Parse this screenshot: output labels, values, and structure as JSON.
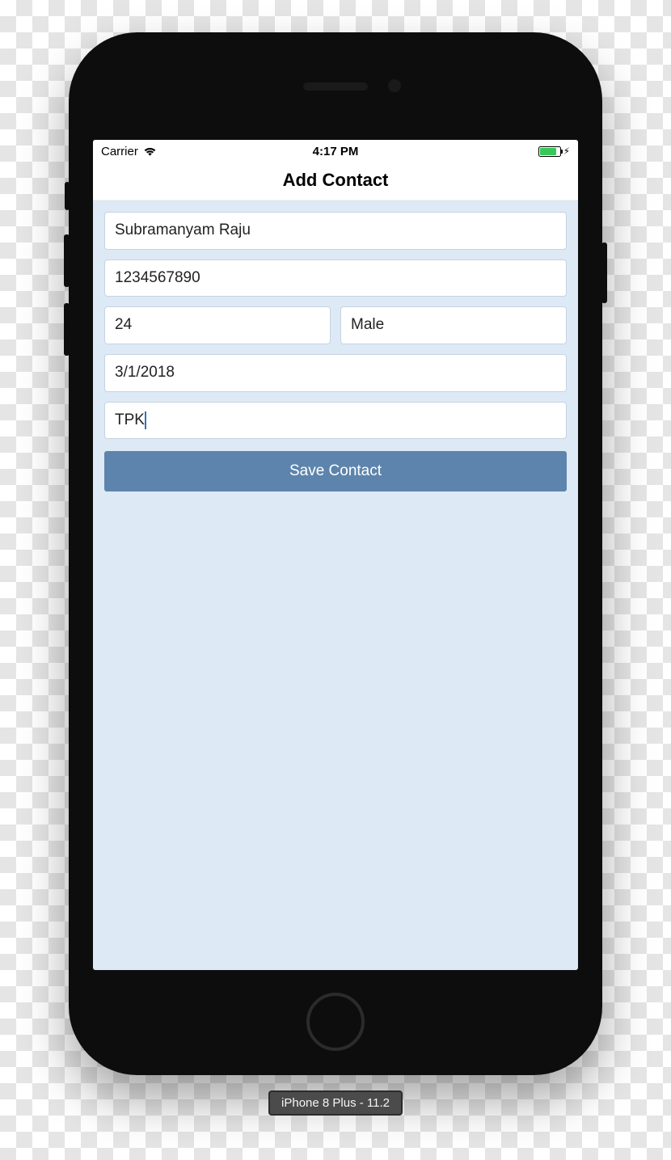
{
  "status": {
    "carrier": "Carrier",
    "time": "4:17 PM"
  },
  "header": {
    "title": "Add Contact"
  },
  "form": {
    "name": "Subramanyam Raju",
    "phone": "1234567890",
    "age": "24",
    "gender": "Male",
    "date": "3/1/2018",
    "code": "TPK",
    "save_label": "Save Contact"
  },
  "device_label": "iPhone 8 Plus - 11.2"
}
